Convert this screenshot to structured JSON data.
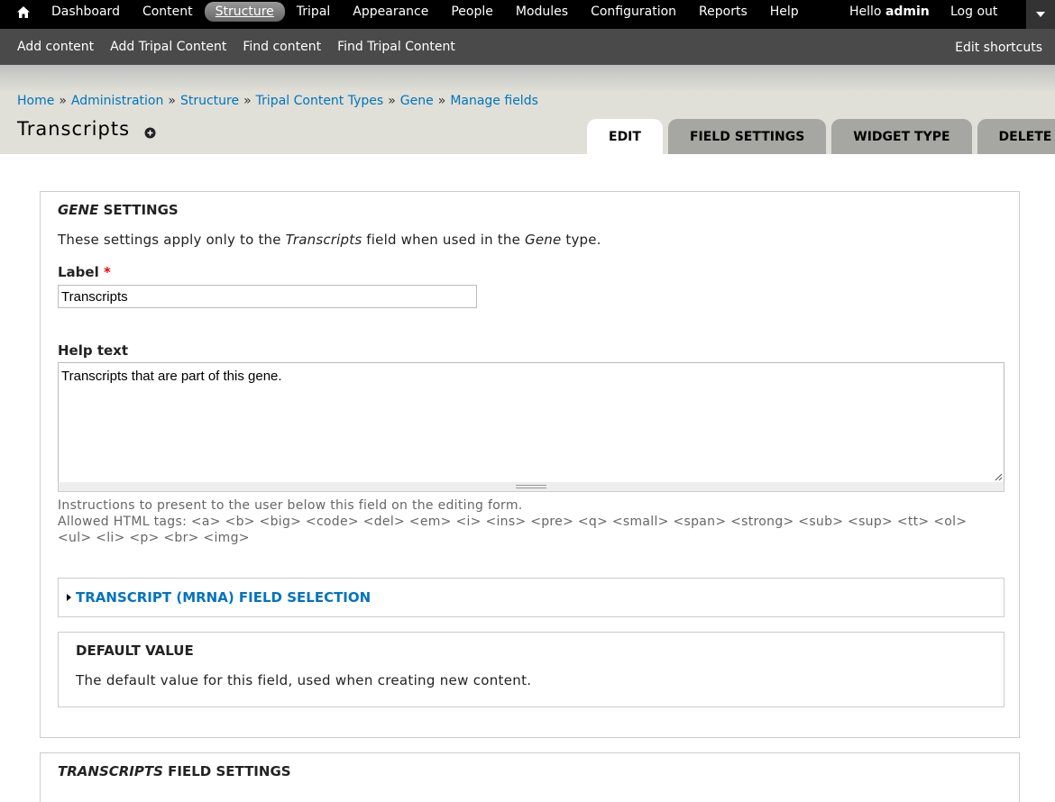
{
  "toolbar": {
    "home_icon": "home-icon",
    "menu": [
      {
        "label": "Dashboard",
        "active": false
      },
      {
        "label": "Content",
        "active": false
      },
      {
        "label": "Structure",
        "active": true
      },
      {
        "label": "Tripal",
        "active": false
      },
      {
        "label": "Appearance",
        "active": false
      },
      {
        "label": "People",
        "active": false
      },
      {
        "label": "Modules",
        "active": false
      },
      {
        "label": "Configuration",
        "active": false
      },
      {
        "label": "Reports",
        "active": false
      },
      {
        "label": "Help",
        "active": false
      }
    ],
    "hello": "Hello",
    "username": "admin",
    "logout": "Log out",
    "toggle_icon": "caret-down-icon"
  },
  "shortcuts": {
    "items": [
      "Add content",
      "Add Tripal Content",
      "Find content",
      "Find Tripal Content"
    ],
    "edit": "Edit shortcuts"
  },
  "breadcrumb": [
    {
      "label": "Home"
    },
    {
      "label": "Administration"
    },
    {
      "label": "Structure"
    },
    {
      "label": "Tripal Content Types"
    },
    {
      "label": "Gene"
    },
    {
      "label": "Manage fields"
    }
  ],
  "breadcrumb_separator": "»",
  "page": {
    "title": "Transcripts",
    "title_icon": "add-shortcut-icon"
  },
  "tabs": [
    {
      "label": "EDIT",
      "active": true
    },
    {
      "label": "FIELD SETTINGS",
      "active": false
    },
    {
      "label": "WIDGET TYPE",
      "active": false
    },
    {
      "label": "DELETE",
      "active": false
    }
  ],
  "gene_settings": {
    "legend_em": "GENE",
    "legend_rest": " SETTINGS",
    "desc_1": "These settings apply only to the ",
    "desc_field": "Transcripts",
    "desc_2": " field when used in the ",
    "desc_type": "Gene",
    "desc_3": " type.",
    "label_label": "Label",
    "required_marker": "*",
    "label_value": "Transcripts",
    "help_label": "Help text",
    "help_value": "Transcripts that are part of this gene.",
    "help_desc_1": "Instructions to present to the user below this field on the editing form.",
    "help_desc_2": "Allowed HTML tags: <a> <b> <big> <code> <del> <em> <i> <ins> <pre> <q> <small> <span> <strong> <sub> <sup> <tt> <ol>",
    "help_desc_3": "<ul> <li> <p> <br> <img>"
  },
  "transcript_selection": {
    "legend": "TRANSCRIPT (MRNA) FIELD SELECTION"
  },
  "default_value": {
    "legend": "DEFAULT VALUE",
    "desc": "The default value for this field, used when creating new content."
  },
  "field_settings": {
    "legend_em": "TRANSCRIPTS",
    "legend_rest": " FIELD SETTINGS"
  },
  "colors": {
    "link": "#0074bd",
    "toolbar_bg": "#000000",
    "shortcut_bg": "#4a4a4a",
    "header_bg": "#e0e0d8",
    "tab_bg": "#a6a7a2",
    "required": "#ee0000"
  }
}
